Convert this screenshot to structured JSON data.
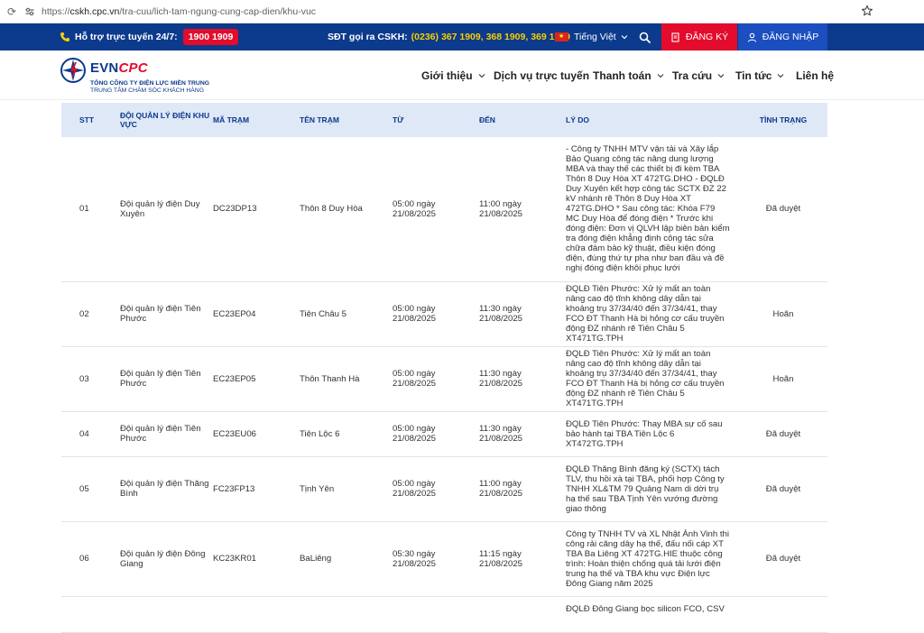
{
  "browser": {
    "url_prefix": "https://",
    "url_domain": "cskh.cpc.vn",
    "url_path": "/tra-cuu/lich-tam-ngung-cung-cap-dien/khu-vuc"
  },
  "topbar": {
    "hotline_label": "Hỗ trợ trực tuyến 24/7:",
    "hotline_number": "1900 1909",
    "cskh_label": "SĐT gọi ra CSKH:",
    "cskh_numbers": "(0236) 367 1909, 368 1909, 369 1909",
    "language": "Tiếng Việt",
    "register": "ĐĂNG KÝ",
    "login": "ĐĂNG NHẬP"
  },
  "logo": {
    "brand_evn": "EVN",
    "brand_cpc": "CPC",
    "sub1": "TỔNG CÔNG TY ĐIỆN LỰC MIỀN TRUNG",
    "sub2": "TRUNG TÂM CHĂM SÓC KHÁCH HÀNG"
  },
  "nav": {
    "items": [
      {
        "label": "Giới thiệu",
        "dropdown": true
      },
      {
        "label": "Dịch vụ trực tuyến",
        "dropdown": false
      },
      {
        "label": "Thanh toán",
        "dropdown": true
      },
      {
        "label": "Tra cứu",
        "dropdown": true
      },
      {
        "label": "Tin tức",
        "dropdown": true
      },
      {
        "label": "Liên hệ",
        "dropdown": false
      }
    ]
  },
  "table": {
    "headers": {
      "stt": "STT",
      "doi": "ĐỘI QUẢN LÝ ĐIỆN KHU VỰC",
      "ma": "MÃ TRẠM",
      "ten": "TÊN TRẠM",
      "tu": "TỪ",
      "den": "ĐẾN",
      "lydo": "LÝ DO",
      "tt": "TÌNH TRẠNG"
    },
    "rows": [
      {
        "stt": "01",
        "doi": "Đội quản lý điện Duy Xuyên",
        "ma": "DC23DP13",
        "ten": "Thôn 8 Duy Hòa",
        "tu": "05:00 ngày 21/08/2025",
        "den": "11:00 ngày 21/08/2025",
        "lydo": "- Công ty TNHH MTV vận tải và Xây lắp Bảo Quang công tác nâng dung lượng MBA và thay thế các thiết bị đi kèm TBA Thôn 8 Duy Hòa XT 472TG.DHO - ĐQLĐ Duy Xuyên kết hợp công tác SCTX ĐZ 22 kV nhánh rẽ Thôn 8 Duy Hòa XT 472TG.DHO * Sau công tác: Khóa F79 MC Duy Hòa để đóng điện * Trước khi đóng điện: Đơn vị QLVH lập biên bản kiểm tra đóng điện khẳng định công tác sửa chữa đảm bảo kỹ thuật, điều kiện đóng điện, đúng thứ tự pha như ban đầu và đề nghị đóng điện khôi phục lưới",
        "tt": "Đã duyệt"
      },
      {
        "stt": "02",
        "doi": "Đội quản lý điện Tiên Phước",
        "ma": "EC23EP04",
        "ten": "Tiên Châu 5",
        "tu": "05:00 ngày 21/08/2025",
        "den": "11:30 ngày 21/08/2025",
        "lydo": "ĐQLĐ Tiên Phước: Xử lý mất an toàn nâng cao độ tĩnh không dây dẫn tại khoảng trụ 37/34/40 đến 37/34/41, thay FCO ĐT Thanh Hà bị hỏng cơ cấu truyền động ĐZ nhánh rẽ Tiên Châu 5 XT471TG.TPH",
        "tt": "Hoãn"
      },
      {
        "stt": "03",
        "doi": "Đội quản lý điện Tiên Phước",
        "ma": "EC23EP05",
        "ten": "Thôn Thanh Hà",
        "tu": "05:00 ngày 21/08/2025",
        "den": "11:30 ngày 21/08/2025",
        "lydo": "ĐQLĐ Tiên Phước: Xử lý mất an toàn nâng cao độ tĩnh không dây dẫn tại khoảng trụ 37/34/40 đến 37/34/41, thay FCO ĐT Thanh Hà bị hỏng cơ cấu truyền động ĐZ nhánh rẽ Tiên Châu 5 XT471TG.TPH",
        "tt": "Hoãn"
      },
      {
        "stt": "04",
        "doi": "Đội quản lý điện Tiên Phước",
        "ma": "EC23EU06",
        "ten": "Tiên Lộc 6",
        "tu": "05:00 ngày 21/08/2025",
        "den": "11:30 ngày 21/08/2025",
        "lydo": "ĐQLĐ Tiên Phước: Thay MBA sự cố sau bảo hành tại TBA Tiên Lộc 6 XT472TG.TPH",
        "tt": "Đã duyệt"
      },
      {
        "stt": "05",
        "doi": "Đội quản lý điện Thăng Bình",
        "ma": "FC23FP13",
        "ten": "Tịnh Yên",
        "tu": "05:00 ngày 21/08/2025",
        "den": "11:00 ngày 21/08/2025",
        "lydo": "ĐQLĐ Thăng Bình đăng ký (SCTX) tách TLV, thu hồi xà tại TBA, phối hợp Công ty TNHH XL&TM 79 Quảng Nam di dời trụ hạ thế sau TBA Tịnh Yên vướng đường giao thông",
        "tt": "Đã duyệt"
      },
      {
        "stt": "06",
        "doi": "Đội quản lý điện Đông Giang",
        "ma": "KC23KR01",
        "ten": "BaLiêng",
        "tu": "05:30 ngày 21/08/2025",
        "den": "11:15 ngày 21/08/2025",
        "lydo": "Công ty TNHH TV và XL Nhật Ánh Vinh thi công rải căng dây hạ thế, đấu nối cáp XT TBA Ba Liêng XT 472TG.HIE thuộc công trình: Hoàn thiện chống quá tải lưới điện trung hạ thế và TBA khu vực Điện lực Đông Giang năm 2025",
        "tt": "Đã duyệt"
      },
      {
        "stt": "",
        "doi": "",
        "ma": "",
        "ten": "",
        "tu": "",
        "den": "",
        "lydo": "ĐQLĐ Đông Giang bọc silicon FCO, CSV",
        "tt": ""
      }
    ]
  }
}
